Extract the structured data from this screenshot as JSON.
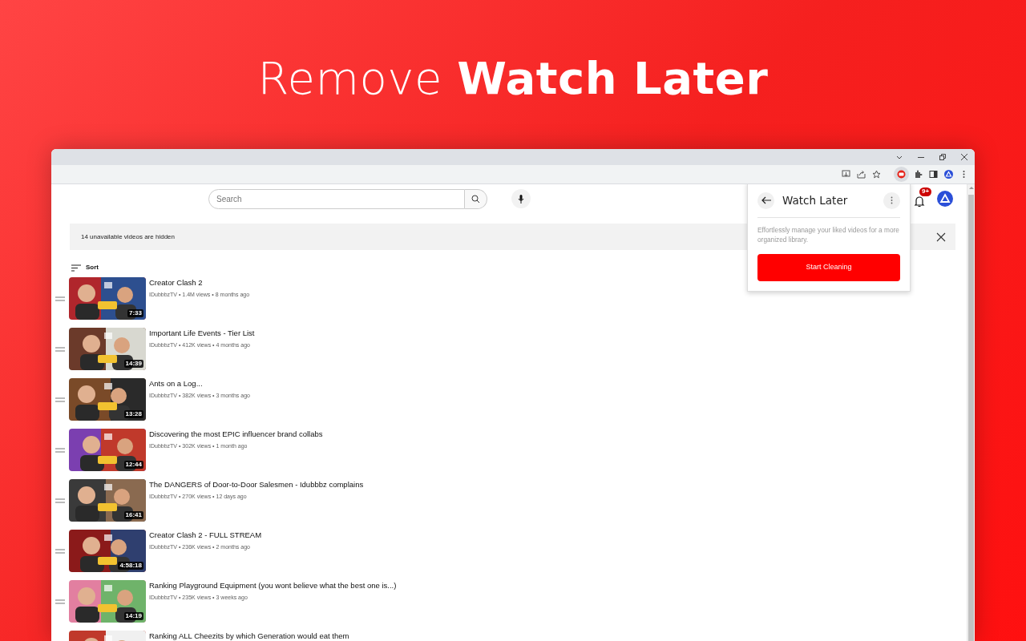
{
  "headline": "Remove **Watch Later**",
  "browser": {
    "extension_active": true
  },
  "search": {
    "placeholder": "Search"
  },
  "notifications": {
    "badge": "9+"
  },
  "banner": {
    "text": "14 unavailable videos are hidden"
  },
  "sort": {
    "label": "Sort"
  },
  "videos": [
    {
      "title": "Creator Clash 2",
      "meta": "IDubbbzTV • 1.4M views • 8 months ago",
      "duration": "7:33"
    },
    {
      "title": "Important Life Events - Tier List",
      "meta": "IDubbbzTV • 412K views • 4 months ago",
      "duration": "14:39"
    },
    {
      "title": "Ants on a Log...",
      "meta": "IDubbbzTV • 382K views • 3 months ago",
      "duration": "13:28"
    },
    {
      "title": "Discovering the most EPIC influencer brand collabs",
      "meta": "IDubbbzTV • 302K views • 1 month ago",
      "duration": "12:44"
    },
    {
      "title": "The DANGERS of Door-to-Door Salesmen - Idubbbz complains",
      "meta": "IDubbbzTV • 270K views • 12 days ago",
      "duration": "16:41"
    },
    {
      "title": "Creator Clash 2 - FULL STREAM",
      "meta": "IDubbbzTV • 236K views • 2 months ago",
      "duration": "4:58:18"
    },
    {
      "title": "Ranking Playground Equipment (you wont believe what the best one is...)",
      "meta": "IDubbbzTV • 235K views • 3 weeks ago",
      "duration": "14:19"
    },
    {
      "title": "Ranking ALL Cheezits by which Generation would eat them"
    }
  ],
  "popup": {
    "title": "Watch Later",
    "description": "Effortlessly manage your liked videos for a more organized library.",
    "button": "Start Cleaning"
  }
}
